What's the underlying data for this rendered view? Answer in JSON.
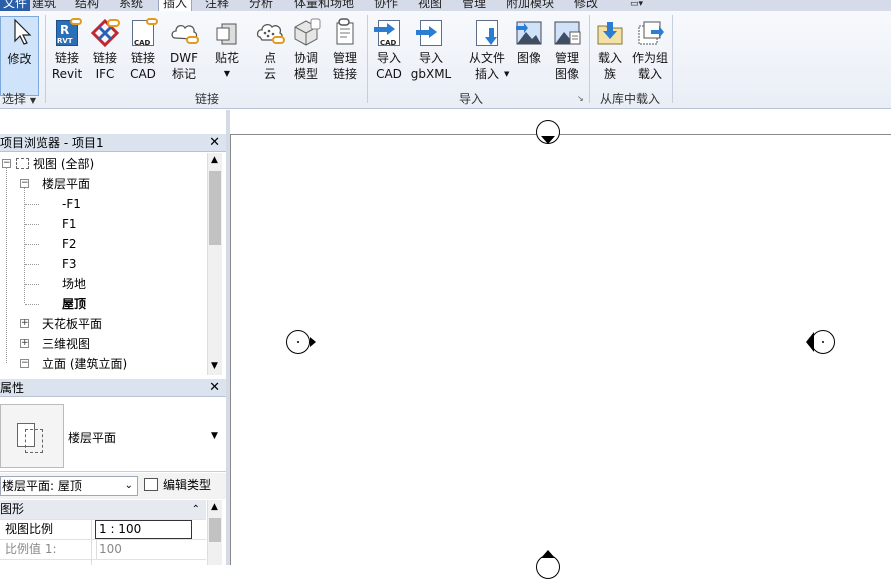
{
  "tabs": {
    "file": "文件",
    "architecture": "建筑",
    "structure": "结构",
    "systems": "系统",
    "insert": "插入",
    "annotate": "注释",
    "analyze": "分析",
    "massing": "体量和场地",
    "collaborate": "协作",
    "view": "视图",
    "manage": "管理",
    "addins": "附加模块",
    "modify": "修改"
  },
  "ribbon": {
    "modify": "修改",
    "select": "选择",
    "link_revit": [
      "链接",
      "Revit"
    ],
    "link_ifc": [
      "链接",
      "IFC"
    ],
    "link_cad": [
      "链接",
      "CAD"
    ],
    "dwf_markup": [
      "DWF",
      "标记"
    ],
    "decal": "贴花",
    "point_cloud": [
      "点",
      "云"
    ],
    "coordination_model": [
      "协调",
      "模型"
    ],
    "manage_links": [
      "管理",
      "链接"
    ],
    "panel_link": "链接",
    "import_cad": [
      "导入",
      "CAD"
    ],
    "import_gbxml": [
      "导入",
      "gbXML"
    ],
    "insert_from_file": [
      "从文件",
      "插入"
    ],
    "image": "图像",
    "manage_images": [
      "管理",
      "图像"
    ],
    "panel_import": "导入",
    "load_family": [
      "载入",
      "族"
    ],
    "load_as_group": [
      "作为组",
      "载入"
    ],
    "panel_load_library": "从库中载入",
    "icon_labels": {
      "rvt": "RVT",
      "cad": "CAD",
      "cad2": "CAD"
    }
  },
  "project_browser": {
    "title": "项目浏览器 - 项目1",
    "views_root": "视图 (全部)",
    "floor_plans": "楼层平面",
    "floor_plan_items": [
      "-F1",
      "F1",
      "F2",
      "F3",
      "场地",
      "屋顶"
    ],
    "ceiling_plans": "天花板平面",
    "views_3d": "三维视图",
    "elevations": "立面 (建筑立面)"
  },
  "properties": {
    "title": "属性",
    "type_name": "楼层平面",
    "instance_selector": "楼层平面: 屋顶",
    "edit_type": "编辑类型",
    "group_graphics": "图形",
    "rows": [
      {
        "label": "视图比例",
        "value": "1 : 100"
      },
      {
        "label": "比例值 1:",
        "value": "100"
      }
    ]
  },
  "colors": {
    "accent": "#2a5ea8",
    "active_btn": "#cfe3fb",
    "panel_header": "#dbe3ef"
  }
}
